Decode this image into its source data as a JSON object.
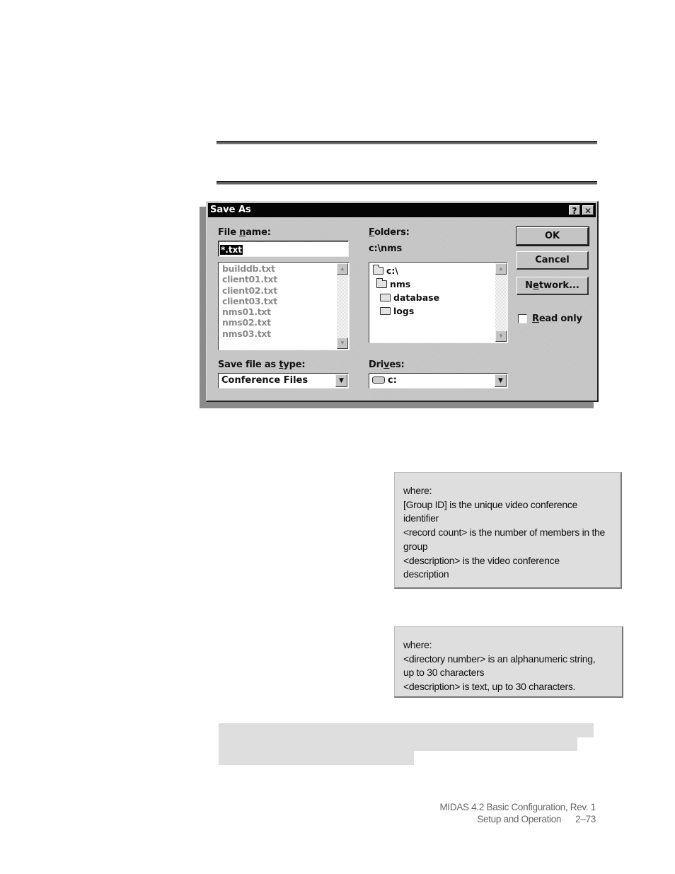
{
  "dialog": {
    "title": "Save As",
    "title_buttons": {
      "help": "?",
      "close": "✕"
    },
    "file_name": {
      "label_pre": "File ",
      "label_u": "n",
      "label_post": "ame:",
      "value": "*.txt"
    },
    "files": [
      "builddb.txt",
      "client01.txt",
      "client02.txt",
      "client03.txt",
      "nms01.txt",
      "nms02.txt",
      "nms03.txt"
    ],
    "folders": {
      "label_u": "F",
      "label_post": "olders:",
      "current_path": "c:\\nms",
      "tree": [
        {
          "name": "c:\\",
          "icon": "open-folder-icon",
          "level": 0
        },
        {
          "name": "nms",
          "icon": "open-folder-icon",
          "level": 1
        },
        {
          "name": "database",
          "icon": "folder-icon",
          "level": 2
        },
        {
          "name": "logs",
          "icon": "folder-icon",
          "level": 2
        }
      ]
    },
    "buttons": {
      "ok": "OK",
      "cancel": "Cancel",
      "network_pre": "N",
      "network_u": "e",
      "network_post": "twork..."
    },
    "read_only": {
      "label_u": "R",
      "label_post": "ead only",
      "checked": false
    },
    "save_type": {
      "label_pre": "Save file as ",
      "label_u": "t",
      "label_post": "ype:",
      "selected": "Conference Files"
    },
    "drives": {
      "label_pre": "Dri",
      "label_u": "v",
      "label_post": "es:",
      "selected": "c:"
    }
  },
  "notes": [
    {
      "lines": [
        "where:",
        "[Group ID] is the unique video conference",
        "identifier",
        "<record count> is the number of members in the",
        "group",
        "<description> is the video conference",
        "description"
      ]
    },
    {
      "lines": [
        "where:",
        "<directory number> is an alphanumeric string,",
        "up to 30 characters",
        "<description> is text, up to 30 characters."
      ]
    }
  ],
  "footer": {
    "line1": "MIDAS 4.2 Basic Configuration, Rev. 1",
    "section": "Setup and Operation",
    "page": "2–73"
  }
}
